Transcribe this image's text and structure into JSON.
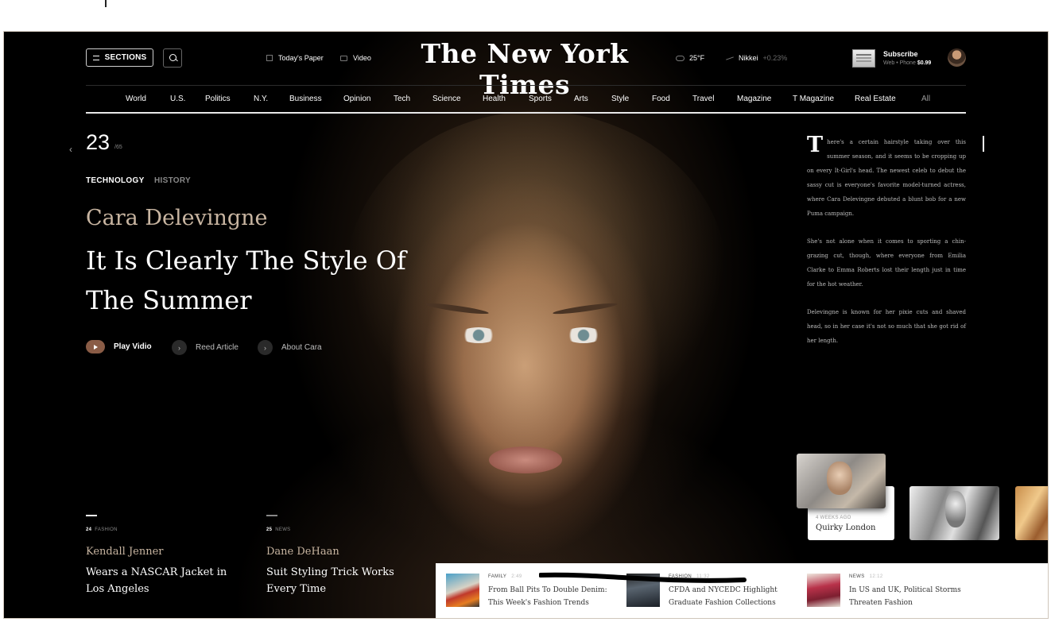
{
  "header": {
    "sections_label": "SECTIONS",
    "todays_paper": "Today's Paper",
    "video": "Video",
    "logo": "The New York Times",
    "temperature": "25°F",
    "nikkei_label": "Nikkei",
    "nikkei_change": "+0.23%",
    "subscribe": "Subscribe",
    "subscribe_devices": "Web • Phone",
    "subscribe_price": "$0.99"
  },
  "nav": [
    "World",
    "U.S.",
    "Politics",
    "N.Y.",
    "Business",
    "Opinion",
    "Tech",
    "Science",
    "Health",
    "Sports",
    "Arts",
    "Style",
    "Food",
    "Travel",
    "Magazine",
    "T Magazine",
    "Real Estate",
    "All"
  ],
  "hero": {
    "counter": "23",
    "counter_total": "/65",
    "category_active": "TECHNOLOGY",
    "category_other": "HISTORY",
    "name": "Cara Delevingne",
    "title": "It Is Clearly The Style Of The Summer",
    "actions": {
      "play": "Play Vidio",
      "read": "Reed Article",
      "about": "About Cara"
    }
  },
  "stories": [
    {
      "num": "24",
      "category": "FASHION",
      "name": "Kendall Jenner",
      "title": "Wears a NASCAR Jacket in Los Angeles"
    },
    {
      "num": "25",
      "category": "NEWS",
      "name": "Dane DeHaan",
      "title": "Suit Styling Trick Works Every Time"
    }
  ],
  "article": {
    "dropcap": "T",
    "p1": "here's a certain hairstyle taking over this summer season, and it seems to be cropping up on every It-Girl's head. The newest celeb to debut the sassy cut is everyone's favorite model-turned actress, where Cara Delevingne debuted a blunt bob for a new Puma campaign.",
    "p2": "She's not alone when it comes to sporting a chin-grazing cut, though, where everyone from Emilia Clarke to Emma Roberts lost their length just in time for the hot weather.",
    "p3": "Delevingne is known for her pixie cuts and shaved head, so in her case it's not so much that she got rid of her length."
  },
  "side_card": {
    "meta": "4 WEEKS AGO",
    "title": "Quirky London"
  },
  "strip": [
    {
      "category": "FAMILY",
      "time": "2:49",
      "title": "From Ball Pits To Double Denim: This Week's Fashion Trends"
    },
    {
      "category": "FASHION",
      "time": "11:32",
      "title": "CFDA and NYCEDC Highlight Graduate Fashion Collections"
    },
    {
      "category": "NEWS",
      "time": "12:12",
      "title": "In US and UK, Political Storms Threaten Fashion"
    }
  ],
  "colors": {
    "accent": "#8a5c46",
    "name_tone": "#c8b5a1",
    "background": "#000000"
  },
  "icons": [
    "menu-icon",
    "search-icon",
    "newspaper-icon",
    "video-icon",
    "weather-icon",
    "trend-icon",
    "play-icon",
    "chevron-right-icon",
    "chevron-left-icon"
  ]
}
